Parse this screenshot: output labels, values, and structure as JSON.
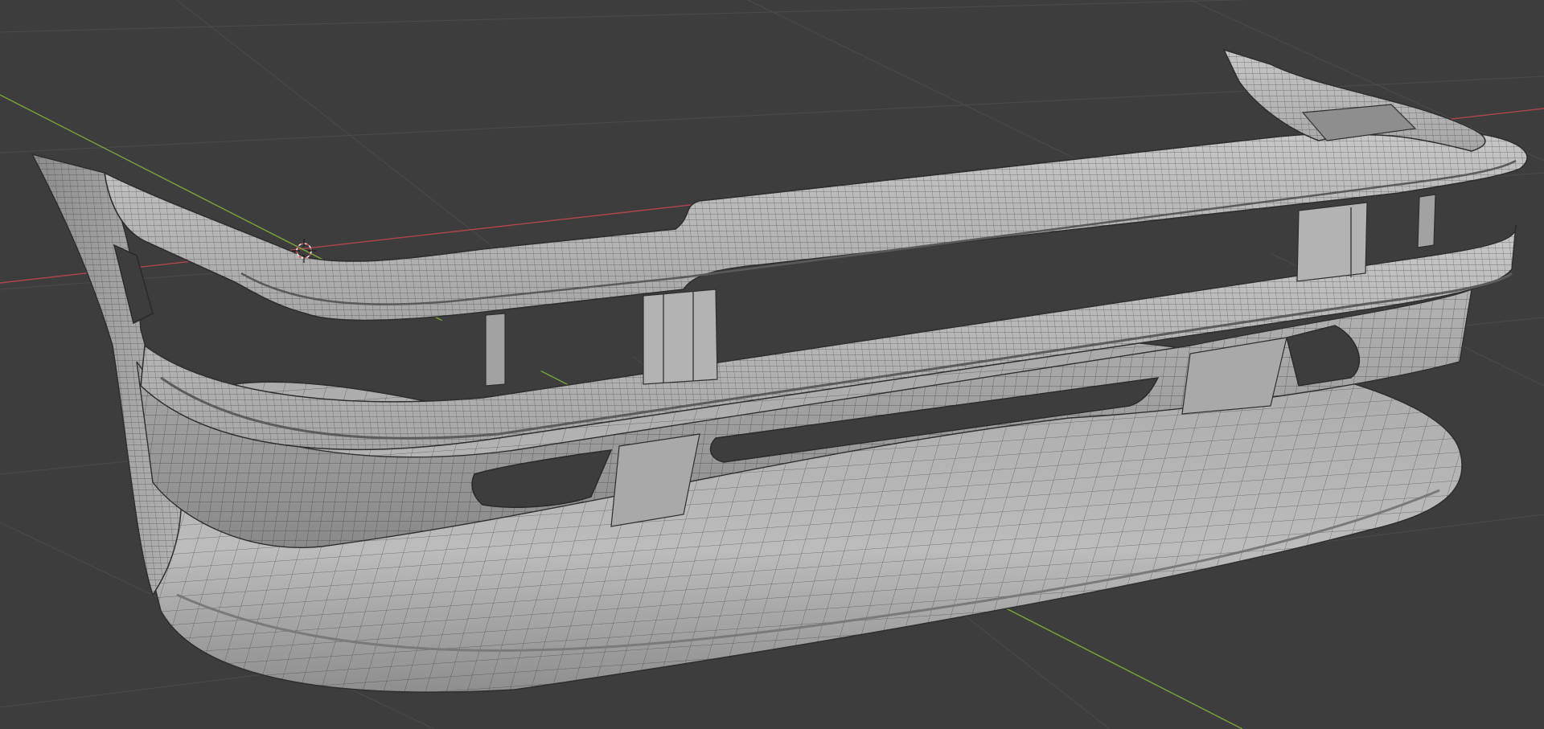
{
  "viewport": {
    "background_color": "#3d3d3d",
    "grid_line_color": "#4a4a4a",
    "x_axis_color": "#b0464d",
    "y_axis_color": "#7aa33c",
    "mesh_fill_color": "#9a9a9a",
    "mesh_highlight_color": "#c4c4c4",
    "mesh_shadow_color": "#6e6e6e",
    "wire_color": "#2e2e2e",
    "view_mode": "solid-with-wireframe",
    "object": "front-bumper-mesh"
  },
  "widgets": {
    "cursor_3d": "3d-cursor-icon"
  }
}
